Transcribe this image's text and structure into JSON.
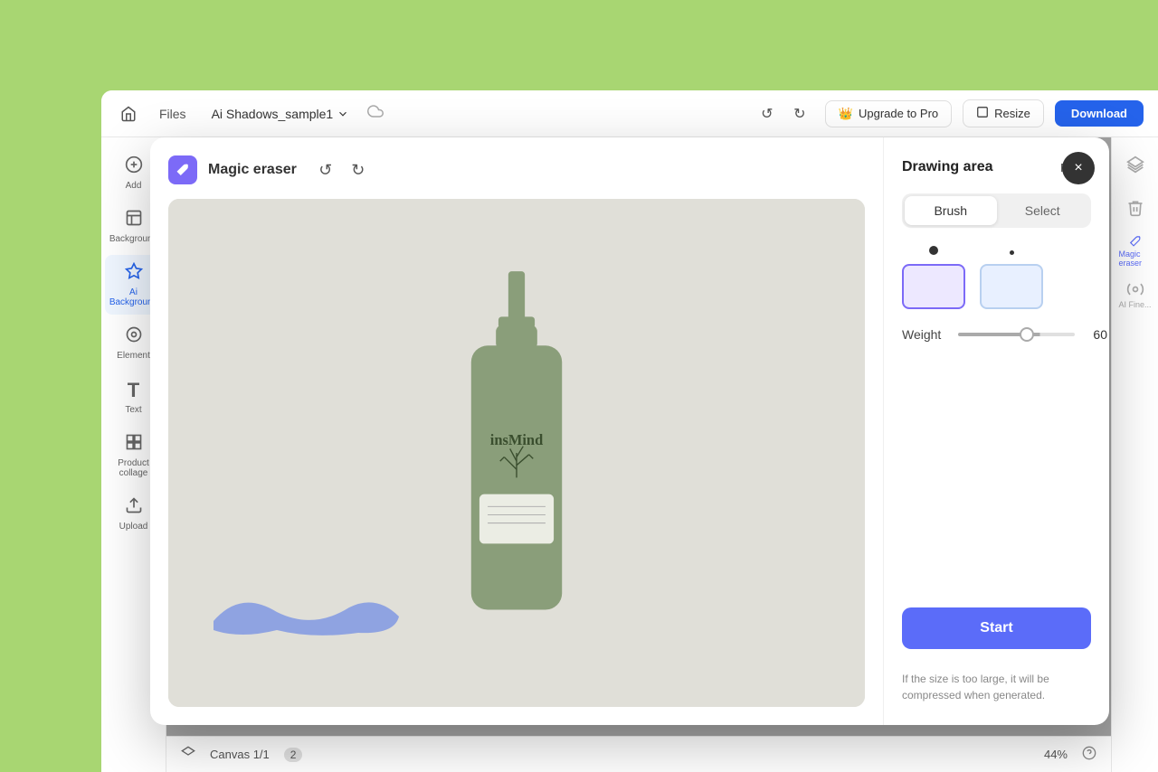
{
  "app": {
    "background_color": "#a8d672"
  },
  "topbar": {
    "files_label": "Files",
    "project_name": "Ai Shadows_sample1",
    "upgrade_label": "Upgrade to Pro",
    "resize_label": "Resize",
    "download_label": "Download"
  },
  "sidebar": {
    "items": [
      {
        "id": "add",
        "label": "Add",
        "icon": "+"
      },
      {
        "id": "background",
        "label": "Background",
        "icon": "▦"
      },
      {
        "id": "ai-background",
        "label": "Ai Background",
        "icon": "✦"
      },
      {
        "id": "element",
        "label": "Element",
        "icon": "◎"
      },
      {
        "id": "text",
        "label": "Text",
        "icon": "T"
      },
      {
        "id": "product-collage",
        "label": "Product collage",
        "icon": "⊞"
      },
      {
        "id": "upload",
        "label": "Upload",
        "icon": "↑"
      }
    ]
  },
  "right_panel": {
    "items": [
      {
        "id": "layers",
        "icon": "⊡"
      },
      {
        "id": "trash",
        "icon": "🗑"
      },
      {
        "id": "magic-eraser",
        "label": "Magic eraser",
        "icon": "✦"
      },
      {
        "id": "ai-fine",
        "label": "AI Fine...",
        "icon": "✧"
      }
    ]
  },
  "bottombar": {
    "canvas_label": "Canvas 1/1",
    "page_count": "2",
    "zoom": "44%"
  },
  "modal": {
    "tool_name": "Magic eraser",
    "close_icon": "×",
    "undo_icon": "↺",
    "redo_icon": "↻",
    "panel": {
      "title": "Drawing area",
      "reset_label": "Reset",
      "brush_label": "Brush",
      "select_label": "Select",
      "weight_label": "Weight",
      "weight_value": "60",
      "start_label": "Start",
      "note": "If the size is too large, it will be compressed when generated."
    }
  }
}
